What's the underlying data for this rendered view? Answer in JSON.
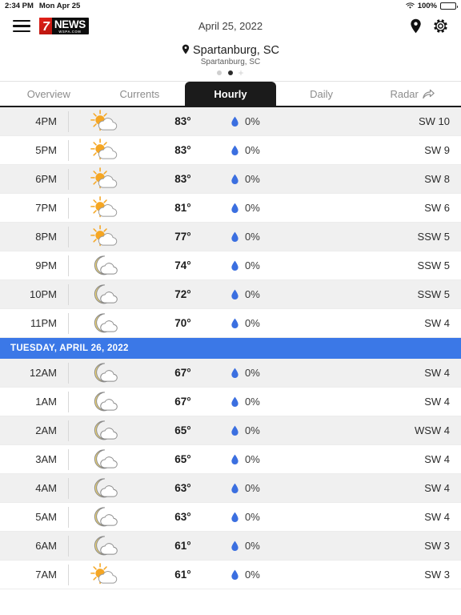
{
  "status_bar": {
    "time": "2:34 PM",
    "date": "Mon Apr 25",
    "battery_text": "100%",
    "wifi_icon": "wifi-icon",
    "battery_icon": "battery-icon"
  },
  "header": {
    "menu_icon": "hamburger-menu-icon",
    "logo_seven": "7",
    "logo_news": "NEWS",
    "logo_domain": "WSPA.COM",
    "date": "April 25, 2022",
    "location_icon": "location-pin-icon",
    "settings_icon": "gear-icon"
  },
  "location": {
    "pin_icon": "location-pin-icon",
    "primary": "Spartanburg, SC",
    "secondary": "Spartanburg, SC",
    "add_label": "+",
    "dots": [
      {
        "active": false
      },
      {
        "active": true
      }
    ]
  },
  "tabs": [
    {
      "label": "Overview",
      "active": false,
      "icon": null
    },
    {
      "label": "Currents",
      "active": false,
      "icon": null
    },
    {
      "label": "Hourly",
      "active": true,
      "icon": null
    },
    {
      "label": "Daily",
      "active": false,
      "icon": null
    },
    {
      "label": "Radar",
      "active": false,
      "icon": "share-arrow-icon"
    }
  ],
  "colors": {
    "accent_blue": "#3b78e7",
    "droplet_blue": "#3b6fe0",
    "sun_orange": "#f5a623",
    "moon_yellow": "#f2d873",
    "row_alt": "#f0f0f0",
    "tab_active_bg": "#1b1b1b",
    "logo_red": "#e32119"
  },
  "hourly": [
    {
      "type": "row",
      "time": "4PM",
      "icon": "sun-cloud-icon",
      "temp": "83°",
      "precip": "0%",
      "wind": "SW 10",
      "alt": true
    },
    {
      "type": "row",
      "time": "5PM",
      "icon": "sun-cloud-icon",
      "temp": "83°",
      "precip": "0%",
      "wind": "SW 9",
      "alt": false
    },
    {
      "type": "row",
      "time": "6PM",
      "icon": "sun-cloud-icon",
      "temp": "83°",
      "precip": "0%",
      "wind": "SW 8",
      "alt": true
    },
    {
      "type": "row",
      "time": "7PM",
      "icon": "sun-cloud-icon",
      "temp": "81°",
      "precip": "0%",
      "wind": "SW 6",
      "alt": false
    },
    {
      "type": "row",
      "time": "8PM",
      "icon": "sun-cloud-icon",
      "temp": "77°",
      "precip": "0%",
      "wind": "SSW 5",
      "alt": true
    },
    {
      "type": "row",
      "time": "9PM",
      "icon": "moon-cloud-icon",
      "temp": "74°",
      "precip": "0%",
      "wind": "SSW 5",
      "alt": false
    },
    {
      "type": "row",
      "time": "10PM",
      "icon": "moon-cloud-icon",
      "temp": "72°",
      "precip": "0%",
      "wind": "SSW 5",
      "alt": true
    },
    {
      "type": "row",
      "time": "11PM",
      "icon": "moon-cloud-icon",
      "temp": "70°",
      "precip": "0%",
      "wind": "SW 4",
      "alt": false
    },
    {
      "type": "divider",
      "label": "TUESDAY, APRIL 26, 2022"
    },
    {
      "type": "row",
      "time": "12AM",
      "icon": "moon-cloud-icon",
      "temp": "67°",
      "precip": "0%",
      "wind": "SW 4",
      "alt": true
    },
    {
      "type": "row",
      "time": "1AM",
      "icon": "moon-cloud-icon",
      "temp": "67°",
      "precip": "0%",
      "wind": "SW 4",
      "alt": false
    },
    {
      "type": "row",
      "time": "2AM",
      "icon": "moon-cloud-icon",
      "temp": "65°",
      "precip": "0%",
      "wind": "WSW 4",
      "alt": true
    },
    {
      "type": "row",
      "time": "3AM",
      "icon": "moon-cloud-icon",
      "temp": "65°",
      "precip": "0%",
      "wind": "SW 4",
      "alt": false
    },
    {
      "type": "row",
      "time": "4AM",
      "icon": "moon-cloud-icon",
      "temp": "63°",
      "precip": "0%",
      "wind": "SW 4",
      "alt": true
    },
    {
      "type": "row",
      "time": "5AM",
      "icon": "moon-cloud-icon",
      "temp": "63°",
      "precip": "0%",
      "wind": "SW 4",
      "alt": false
    },
    {
      "type": "row",
      "time": "6AM",
      "icon": "moon-cloud-icon",
      "temp": "61°",
      "precip": "0%",
      "wind": "SW 3",
      "alt": true
    },
    {
      "type": "row",
      "time": "7AM",
      "icon": "sun-cloud-icon",
      "temp": "61°",
      "precip": "0%",
      "wind": "SW 3",
      "alt": false
    }
  ]
}
